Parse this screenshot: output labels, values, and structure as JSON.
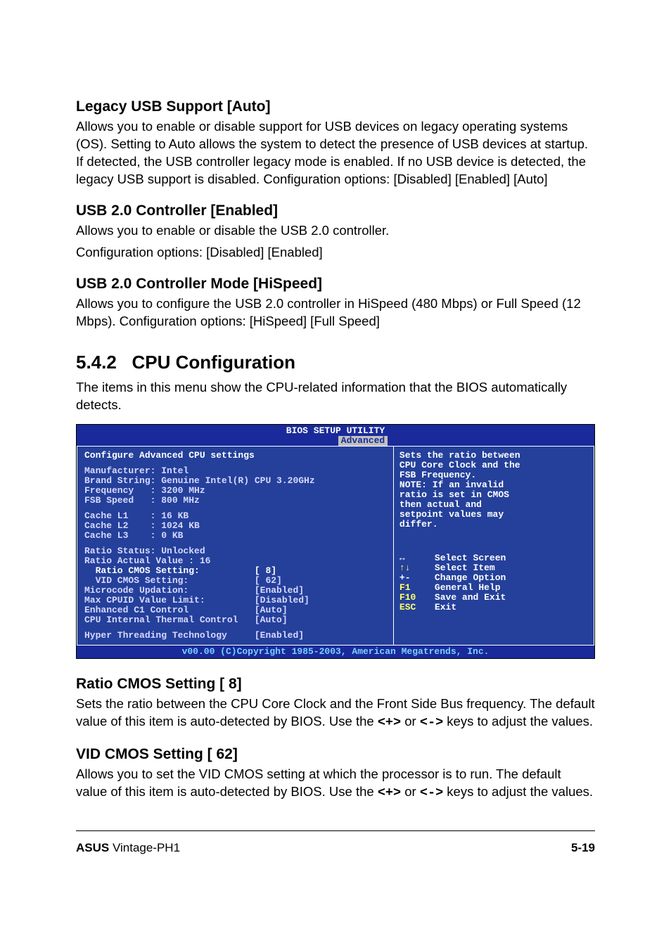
{
  "sec1": {
    "title": "Legacy USB Support [Auto]",
    "body": "Allows you to enable or disable support for USB devices on legacy operating systems (OS). Setting to Auto allows the system to detect the presence of USB devices at startup. If detected, the USB controller legacy mode is enabled. If no USB device is detected, the legacy USB support is disabled. Configuration options: [Disabled] [Enabled] [Auto]"
  },
  "sec2": {
    "title": "USB 2.0 Controller [Enabled]",
    "body1": "Allows you to enable or disable the USB 2.0 controller.",
    "body2": "Configuration options: [Disabled] [Enabled]"
  },
  "sec3": {
    "title": "USB 2.0 Controller Mode [HiSpeed]",
    "body": "Allows you to configure the USB 2.0 controller in HiSpeed (480 Mbps) or Full Speed (12 Mbps). Configuration options: [HiSpeed] [Full Speed]"
  },
  "cpucfg": {
    "num": "5.4.2",
    "title": "CPU Configuration",
    "body": "The items in this menu show the CPU-related information that the BIOS automatically detects."
  },
  "bios": {
    "title": "BIOS SETUP UTILITY",
    "tab": "Advanced",
    "left": {
      "hdr": "Configure Advanced CPU settings",
      "l1": "Manufacturer: Intel",
      "l2": "Brand String: Genuine Intel(R) CPU 3.20GHz",
      "l3": "Frequency   : 3200 MHz",
      "l4": "FSB Speed   : 800 MHz",
      "l5": "Cache L1    : 16 KB",
      "l6": "Cache L2    : 1024 KB",
      "l7": "Cache L3    : 0 KB",
      "l8": "Ratio Status: Unlocked",
      "l9": "Ratio Actual Value : 16",
      "l10": "  Ratio CMOS Setting:          [ 8]",
      "l11": "  VID CMOS Setting:            [ 62]",
      "l12": "Microcode Updation:            [Enabled]",
      "l13": "Max CPUID Value Limit:         [Disabled]",
      "l14": "Enhanced C1 Control            [Auto]",
      "l15": "CPU Internal Thermal Control   [Auto]",
      "l16": "Hyper Threading Technology     [Enabled]"
    },
    "right": {
      "h1": "Sets the ratio between",
      "h2": "CPU Core Clock and the",
      "h3": "FSB Frequency.",
      "h4": "NOTE: If an invalid",
      "h5": "ratio is set in CMOS",
      "h6": "then actual and",
      "h7": "setpoint values may",
      "h8": "differ.",
      "nav": [
        {
          "k": "↔",
          "l": "Select Screen"
        },
        {
          "k": "↑↓",
          "l": "Select Item"
        },
        {
          "k": "+-",
          "l": "Change Option"
        },
        {
          "k": "F1",
          "l": "General Help"
        },
        {
          "k": "F10",
          "l": "Save and Exit"
        },
        {
          "k": "ESC",
          "l": "Exit"
        }
      ]
    },
    "copy": "v00.00 (C)Copyright 1985-2003, American Megatrends, Inc."
  },
  "sec4": {
    "title": "Ratio CMOS Setting [ 8]",
    "b1": "Sets the ratio between the CPU Core Clock and the Front Side Bus frequency. The default value of this item is auto-detected by BIOS. Use the ",
    "k1": "<+>",
    "b2": " or ",
    "k2": "<->",
    "b3": " keys to adjust the values."
  },
  "sec5": {
    "title": "VID CMOS Setting [ 62]",
    "b1": "Allows you to set the VID CMOS setting at which the processor is to run. The default value of this item is auto-detected by BIOS. Use the ",
    "k1": "<+>",
    "b2": " or ",
    "k2": "<->",
    "b3": " keys to adjust the values."
  },
  "footer": {
    "brand": "ASUS",
    "model": " Vintage-PH1",
    "page": "5-19"
  }
}
